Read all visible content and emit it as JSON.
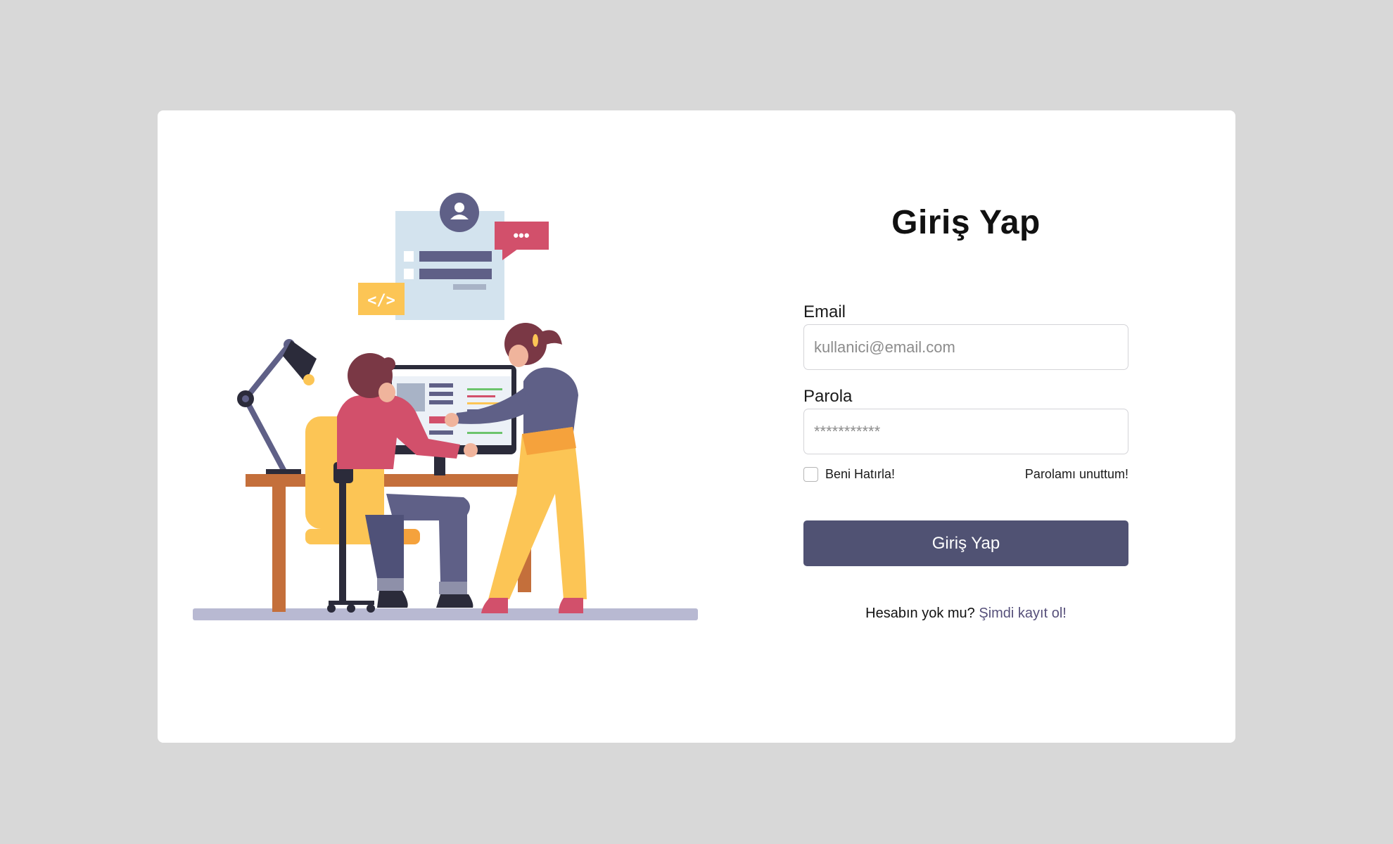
{
  "login": {
    "title": "Giriş Yap",
    "email_label": "Email",
    "email_placeholder": "kullanici@email.com",
    "password_label": "Parola",
    "password_placeholder": "***********",
    "remember_label": "Beni Hatırla!",
    "forgot_label": "Parolamı unuttum!",
    "submit_label": "Giriş Yap",
    "signup_prompt": "Hesabın yok mu?",
    "signup_link": "Şimdi kayıt ol!"
  },
  "illustration": {
    "code_badge": "</>",
    "chat_dots": "•••"
  },
  "colors": {
    "page_background": "#d8d8d8",
    "card_background": "#ffffff",
    "button": "#505273",
    "link": "#56507a"
  }
}
